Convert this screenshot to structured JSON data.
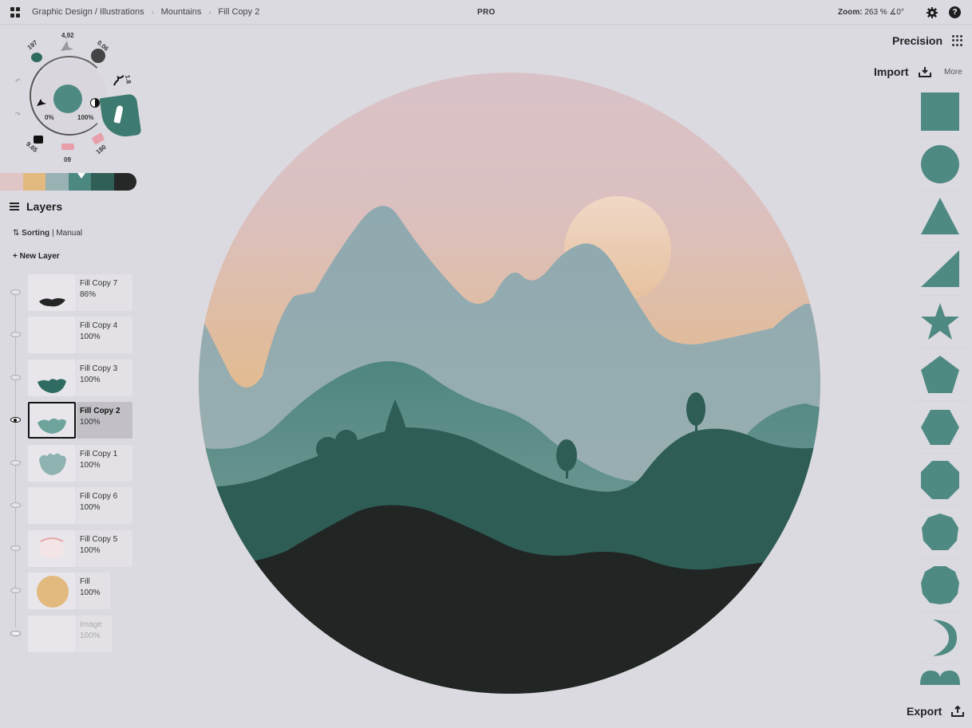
{
  "topbar": {
    "breadcrumbs": [
      "Graphic Design / Illustrations",
      "Mountains",
      "Fill Copy 2"
    ],
    "badge": "PRO",
    "zoom_label": "Zoom:",
    "zoom_value": "263 % ∡0°",
    "icons": [
      "apps-grid-icon",
      "gear-icon",
      "help-icon"
    ],
    "help_glyph": "?"
  },
  "brush_wheel": {
    "current_color": "#4f8a82",
    "opacity_left": "0%",
    "opacity_right": "100%",
    "labels": {
      "size_top": "4,92",
      "left_top": "197",
      "right_top": "0.06",
      "right_mid": "1.8",
      "bottom_left": "9.65",
      "bottom_center": "09",
      "bottom_right": "180"
    }
  },
  "palette": {
    "swatches": [
      "#dfc5c6",
      "#e2b97e",
      "#98b1b3",
      "#4d8880",
      "#2f5f56",
      "#262827"
    ],
    "selected_index": 3
  },
  "layers": {
    "title": "Layers",
    "sorting_label": "Sorting",
    "sorting_value": "Manual",
    "new_layer_label": "+ New Layer",
    "items": [
      {
        "name": "Fill Copy 7",
        "opacity": "86%",
        "visible": true,
        "active": false,
        "thumb": "dark-wave"
      },
      {
        "name": "Fill Copy 4",
        "opacity": "100%",
        "visible": true,
        "active": false,
        "thumb": "empty"
      },
      {
        "name": "Fill Copy 3",
        "opacity": "100%",
        "visible": true,
        "active": false,
        "thumb": "teal-wave"
      },
      {
        "name": "Fill Copy 2",
        "opacity": "100%",
        "visible": true,
        "active": true,
        "thumb": "light-teal-wave"
      },
      {
        "name": "Fill Copy 1",
        "opacity": "100%",
        "visible": true,
        "active": false,
        "thumb": "pale-teal-wave"
      },
      {
        "name": "Fill Copy 6",
        "opacity": "100%",
        "visible": true,
        "active": false,
        "thumb": "empty"
      },
      {
        "name": "Fill Copy 5",
        "opacity": "100%",
        "visible": true,
        "active": false,
        "thumb": "pink-glow"
      },
      {
        "name": "Fill",
        "opacity": "100%",
        "visible": true,
        "active": false,
        "thumb": "orange-circle"
      },
      {
        "name": "Image",
        "opacity": "100%",
        "visible": false,
        "active": false,
        "thumb": "empty"
      }
    ]
  },
  "right_panel": {
    "precision_label": "Precision",
    "import_label": "Import",
    "more_label": "More",
    "export_label": "Export",
    "shape_color": "#4f8a82",
    "shapes": [
      "square",
      "circle",
      "triangle",
      "right-triangle",
      "star",
      "pentagon",
      "hexagon",
      "octagon",
      "nonagon",
      "decagon",
      "crescent",
      "double-arch"
    ]
  },
  "artwork": {
    "colors": {
      "sky_top": "#d9c1c6",
      "sky_bottom": "#e2ba8c",
      "sun": "#eccbb4",
      "far_mountains": "#90aab0",
      "mid_hills": "#5a8a84",
      "near_hills": "#2f5e55",
      "foreground": "#222624",
      "trees": "#2f5e55"
    }
  }
}
